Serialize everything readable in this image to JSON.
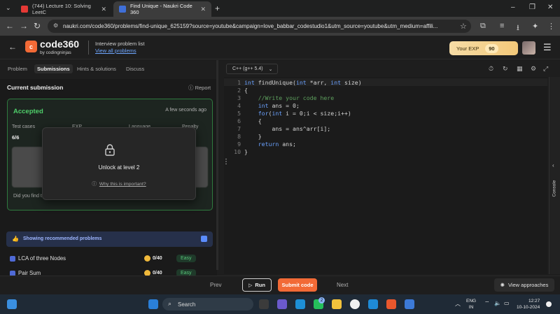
{
  "browser": {
    "tabs": [
      {
        "title": "(744) Lecture 10: Solving LeetC",
        "active": false,
        "favicon_color": "#e53935"
      },
      {
        "title": "Find Unique - Naukri Code 360",
        "active": true,
        "favicon_color": "#3f6fd8"
      }
    ],
    "url": "naukri.com/code360/problems/find-unique_625159?source=youtube&campaign=love_babbar_codestudio1&utm_source=youtube&utm_medium=affili..."
  },
  "header": {
    "logo_text": "code360",
    "logo_sub": "by codingninjas",
    "interview_list": "Interview problem list",
    "view_all": "View all problems",
    "exp_label": "Your EXP",
    "exp_value": "90"
  },
  "left_panel": {
    "tabs": [
      "Problem",
      "Submissions",
      "Hints & solutions",
      "Discuss"
    ],
    "active_tab": "Submissions",
    "section_title": "Current submission",
    "report_label": "Report",
    "status": "Accepted",
    "status_time": "A few seconds ago",
    "stats": [
      {
        "label": "Test cases",
        "value": "6/6"
      },
      {
        "label": "EXP",
        "value": ""
      },
      {
        "label": "Language",
        "value": ""
      },
      {
        "label": "Penalty",
        "value": "0%"
      }
    ],
    "did_you_find": "Did you find t",
    "lock_modal": {
      "text": "Unlock at level 2",
      "link": "Why this is important?"
    },
    "recommended_label": "Showing recommended problems",
    "problems": [
      {
        "name": "LCA of three Nodes",
        "coins": "0/40",
        "difficulty": "Easy"
      },
      {
        "name": "Pair Sum",
        "coins": "0/40",
        "difficulty": "Easy"
      }
    ]
  },
  "editor": {
    "language": "C++ (g++ 5.4)",
    "lines": [
      "int findUnique(int *arr, int size)",
      "{",
      "    //Write your code here",
      "    int ans = 0;",
      "    for(int i = 0;i < size;i++)",
      "    {",
      "        ans = ans^arr[i];",
      "    }",
      "    return ans;",
      "}"
    ],
    "console_label": "Console"
  },
  "actions": {
    "prev": "Prev",
    "run": "Run",
    "submit": "Submit code",
    "next": "Next",
    "view_approaches": "View approaches"
  },
  "taskbar": {
    "search": "Search",
    "lang": "ENG",
    "region": "IN",
    "time": "12:27",
    "date": "10-10-2024",
    "chat_badge": "2"
  },
  "colors": {
    "accent": "#f26a36",
    "accepted": "#4fcf6a",
    "keyword": "#6aa1ff",
    "comment": "#5ea05e"
  }
}
